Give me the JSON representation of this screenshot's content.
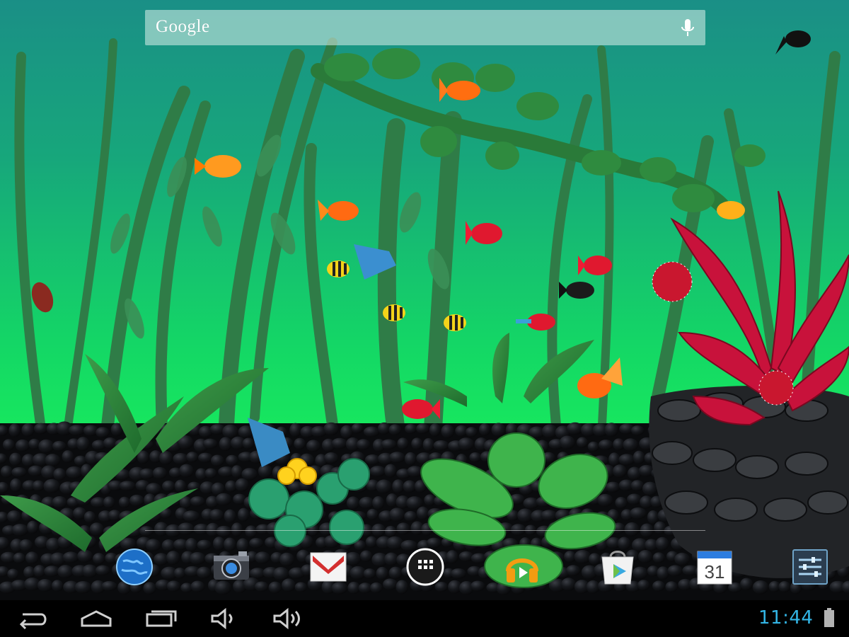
{
  "search": {
    "logo_text": "Google",
    "mic_icon": "microphone-icon"
  },
  "wallpaper": {
    "description_icon": "aquarium-live-wallpaper",
    "colors": {
      "water_top": "#1a8f86",
      "water_mid": "#17c96a",
      "water_bottom": "#19f05a",
      "gravel": "#0c0d0f"
    }
  },
  "dock": {
    "apps": [
      {
        "icon": "browser-globe-icon"
      },
      {
        "icon": "camera-icon"
      },
      {
        "icon": "gmail-icon"
      },
      {
        "icon": "app-drawer-icon"
      },
      {
        "icon": "play-music-icon"
      },
      {
        "icon": "play-store-icon"
      },
      {
        "icon": "calendar-icon",
        "day": "31"
      },
      {
        "icon": "settings-icon"
      }
    ]
  },
  "navbar": {
    "buttons": [
      {
        "icon": "back-icon"
      },
      {
        "icon": "home-icon"
      },
      {
        "icon": "recent-apps-icon"
      },
      {
        "icon": "volume-down-icon"
      },
      {
        "icon": "volume-up-icon"
      }
    ],
    "clock": "11:44",
    "accent": "#33b5e5",
    "battery_icon": "battery-icon"
  }
}
